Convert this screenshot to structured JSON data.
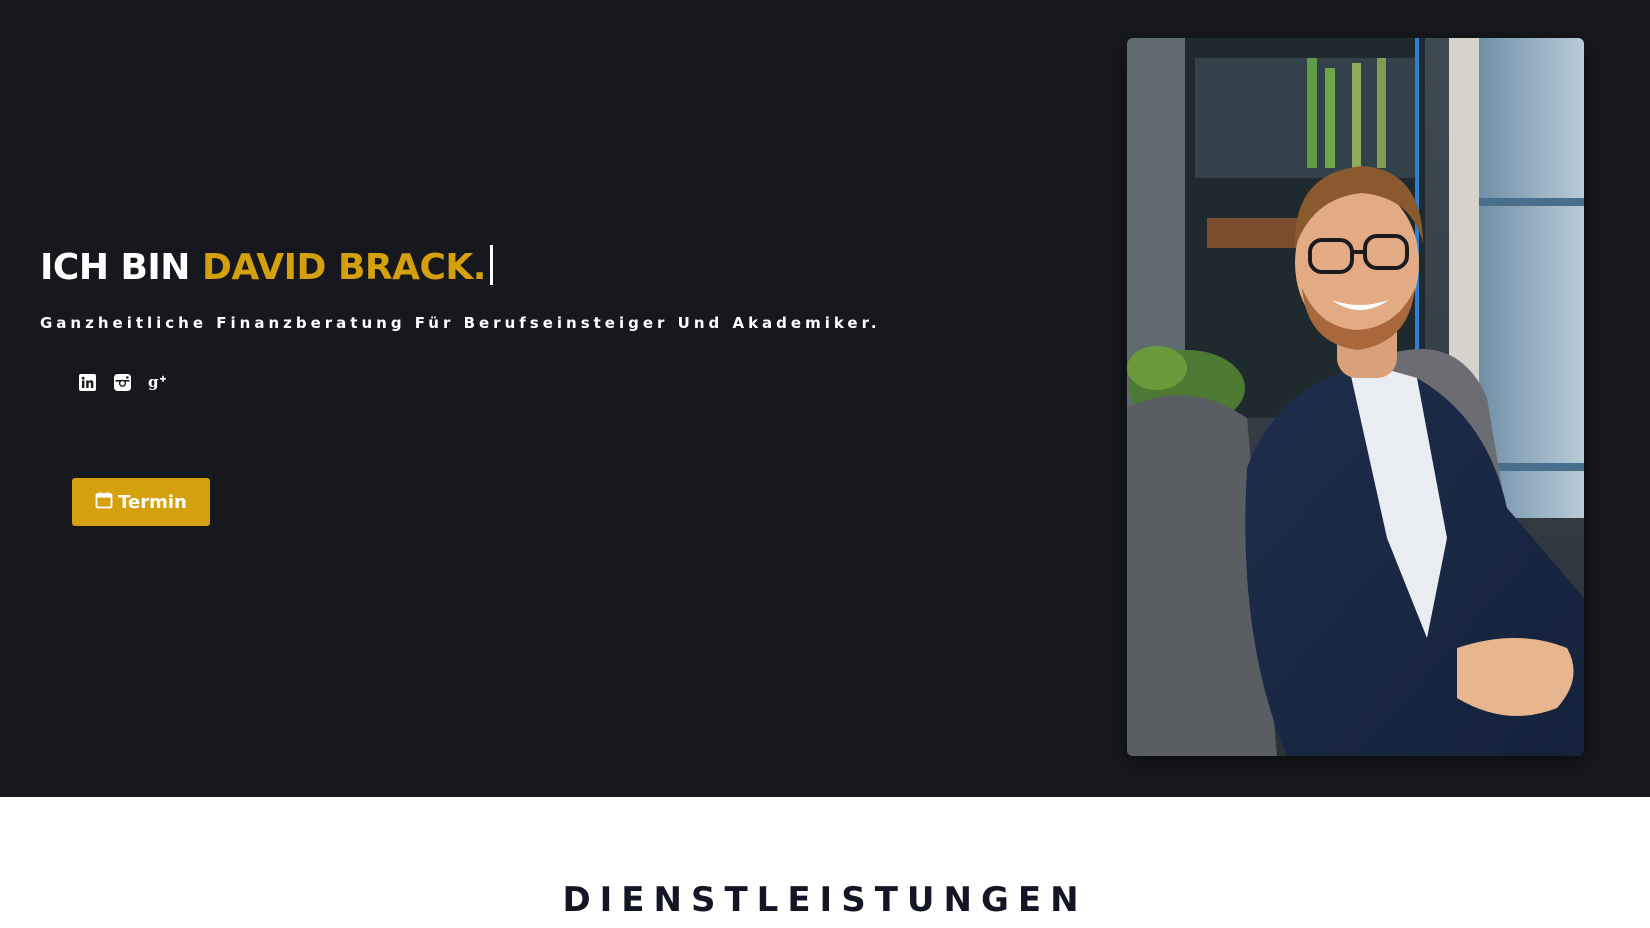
{
  "hero": {
    "headline_prefix": "ICH BIN ",
    "headline_name": "DAVID BRACK.",
    "subtitle": "Ganzheitliche Finanzberatung Für Berufseinsteiger Und Akademiker.",
    "socials": [
      {
        "icon": "linkedin-icon"
      },
      {
        "icon": "instagram-icon"
      },
      {
        "icon": "google-plus-icon"
      }
    ],
    "cta": {
      "icon": "calendar-icon",
      "label": "Termin"
    },
    "photo": {
      "subject": "portrait"
    }
  },
  "services": {
    "title": "DIENSTLEISTUNGEN"
  },
  "colors": {
    "hero_background": "#17181d",
    "accent": "#d4a00d",
    "heading_dark": "#141626",
    "text_light": "#ffffff"
  }
}
